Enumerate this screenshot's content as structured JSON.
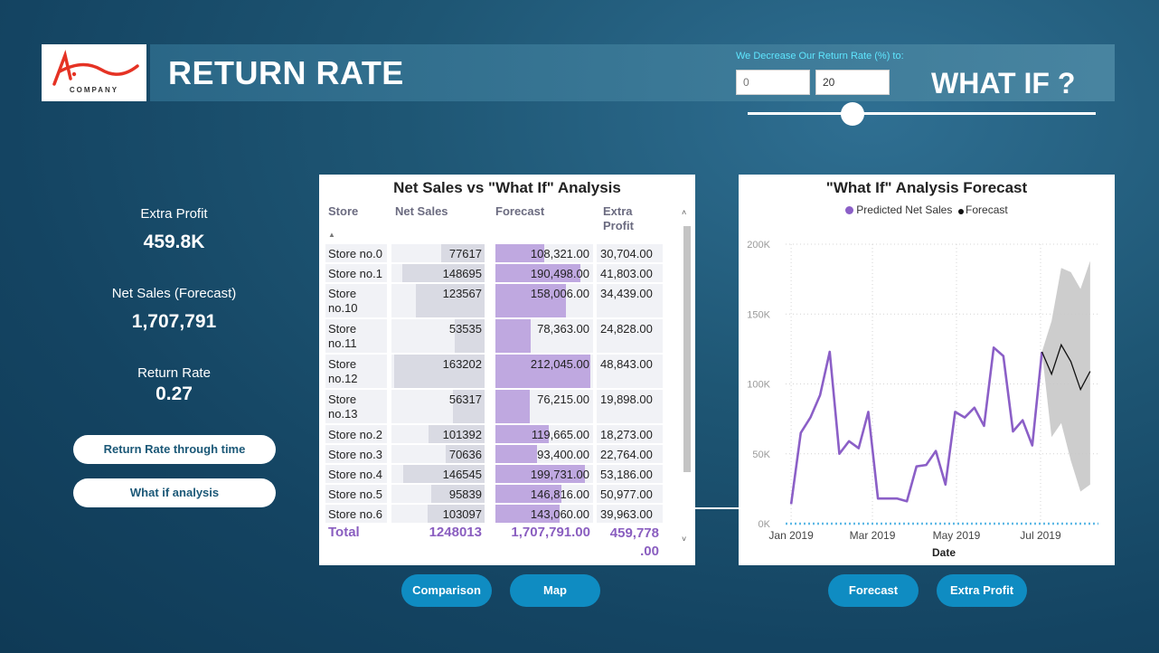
{
  "header": {
    "logo_text": "COMPANY",
    "title": "RETURN RATE",
    "whatif_label": "We Decrease Our Return Rate (%) to:",
    "whatif_min_placeholder": "0",
    "whatif_value": "20",
    "whatif_title": "WHAT IF ?",
    "slider_fraction": 0.3
  },
  "kpis": [
    {
      "label": "Extra Profit",
      "value": "459.8K"
    },
    {
      "label": "Net Sales (Forecast)",
      "value": "1,707,791"
    },
    {
      "label": "Return Rate",
      "value": "0.27"
    }
  ],
  "nav_buttons": {
    "return_rate_time": "Return Rate through time",
    "what_if": "What if analysis"
  },
  "bottom_buttons": {
    "comparison": "Comparison",
    "map": "Map",
    "forecast": "Forecast",
    "extra_profit": "Extra Profit"
  },
  "table": {
    "title": "Net Sales vs \"What If\" Analysis",
    "columns": [
      "Store",
      "Net Sales",
      "Forecast",
      "Extra\nProfit"
    ],
    "rows": [
      {
        "store": "Store no.0",
        "net_sales": 77617,
        "net_sales_label": "77617",
        "forecast": 108321,
        "forecast_label": "108,321.00",
        "extra_profit": "30,704.00"
      },
      {
        "store": "Store no.1",
        "net_sales": 148695,
        "net_sales_label": "148695",
        "forecast": 190498,
        "forecast_label": "190,498.00",
        "extra_profit": "41,803.00"
      },
      {
        "store": "Store no.10",
        "net_sales": 123567,
        "net_sales_label": "123567",
        "forecast": 158006,
        "forecast_label": "158,006.00",
        "extra_profit": "34,439.00"
      },
      {
        "store": "Store no.11",
        "net_sales": 53535,
        "net_sales_label": "53535",
        "forecast": 78363,
        "forecast_label": "78,363.00",
        "extra_profit": "24,828.00"
      },
      {
        "store": "Store no.12",
        "net_sales": 163202,
        "net_sales_label": "163202",
        "forecast": 212045,
        "forecast_label": "212,045.00",
        "extra_profit": "48,843.00"
      },
      {
        "store": "Store no.13",
        "net_sales": 56317,
        "net_sales_label": "56317",
        "forecast": 76215,
        "forecast_label": "76,215.00",
        "extra_profit": "19,898.00"
      },
      {
        "store": "Store no.2",
        "net_sales": 101392,
        "net_sales_label": "101392",
        "forecast": 119665,
        "forecast_label": "119,665.00",
        "extra_profit": "18,273.00"
      },
      {
        "store": "Store no.3",
        "net_sales": 70636,
        "net_sales_label": "70636",
        "forecast": 93400,
        "forecast_label": "93,400.00",
        "extra_profit": "22,764.00"
      },
      {
        "store": "Store no.4",
        "net_sales": 146545,
        "net_sales_label": "146545",
        "forecast": 199731,
        "forecast_label": "199,731.00",
        "extra_profit": "53,186.00"
      },
      {
        "store": "Store no.5",
        "net_sales": 95839,
        "net_sales_label": "95839",
        "forecast": 146816,
        "forecast_label": "146,816.00",
        "extra_profit": "50,977.00"
      },
      {
        "store": "Store no.6",
        "net_sales": 103097,
        "net_sales_label": "103097",
        "forecast": 143060,
        "forecast_label": "143,060.00",
        "extra_profit": "39,963.00"
      }
    ],
    "total": {
      "label": "Total",
      "net_sales": "1248013",
      "forecast": "1,707,791.00",
      "extra_profit": "459,778\n.00"
    }
  },
  "chart_data": {
    "type": "line",
    "title": "\"What If\" Analysis Forecast",
    "xlabel": "Date",
    "ylabel": "",
    "x_ticks": [
      "Jan 2019",
      "Mar 2019",
      "May 2019",
      "Jul 2019"
    ],
    "y_ticks": [
      "0K",
      "50K",
      "100K",
      "150K",
      "200K"
    ],
    "ylim": [
      0,
      200000
    ],
    "grid": true,
    "legend": "top-center",
    "colors": {
      "predicted": "#8b5fc7",
      "forecast": "#111111",
      "band": "#c8c8c8",
      "zero_line": "#5cb8e6"
    },
    "series": [
      {
        "name": "Predicted Net Sales",
        "x": [
          "2019-01-01",
          "2019-01-08",
          "2019-01-15",
          "2019-01-22",
          "2019-01-29",
          "2019-02-05",
          "2019-02-12",
          "2019-02-19",
          "2019-02-26",
          "2019-03-05",
          "2019-03-12",
          "2019-03-19",
          "2019-03-26",
          "2019-04-02",
          "2019-04-09",
          "2019-04-16",
          "2019-04-23",
          "2019-04-30",
          "2019-05-07",
          "2019-05-14",
          "2019-05-21",
          "2019-05-28",
          "2019-06-04",
          "2019-06-11",
          "2019-06-18",
          "2019-06-25",
          "2019-07-02"
        ],
        "values": [
          14000,
          65000,
          76000,
          92000,
          123000,
          50000,
          59000,
          54000,
          80000,
          18000,
          18000,
          18000,
          16000,
          41000,
          42000,
          52000,
          28000,
          80000,
          76000,
          83000,
          70000,
          126000,
          120000,
          66000,
          74000,
          56000,
          123000
        ]
      },
      {
        "name": "Forecast",
        "x": [
          "2019-07-02",
          "2019-07-09",
          "2019-07-16",
          "2019-07-23",
          "2019-07-30",
          "2019-08-06"
        ],
        "values": [
          123000,
          107000,
          128000,
          116000,
          96000,
          109000
        ]
      }
    ],
    "band": {
      "x": [
        "2019-07-02",
        "2019-07-09",
        "2019-07-16",
        "2019-07-23",
        "2019-07-30",
        "2019-08-06"
      ],
      "upper": [
        123000,
        145000,
        183000,
        180000,
        168000,
        188000
      ],
      "lower": [
        123000,
        62000,
        72000,
        45000,
        23000,
        28000
      ]
    }
  }
}
